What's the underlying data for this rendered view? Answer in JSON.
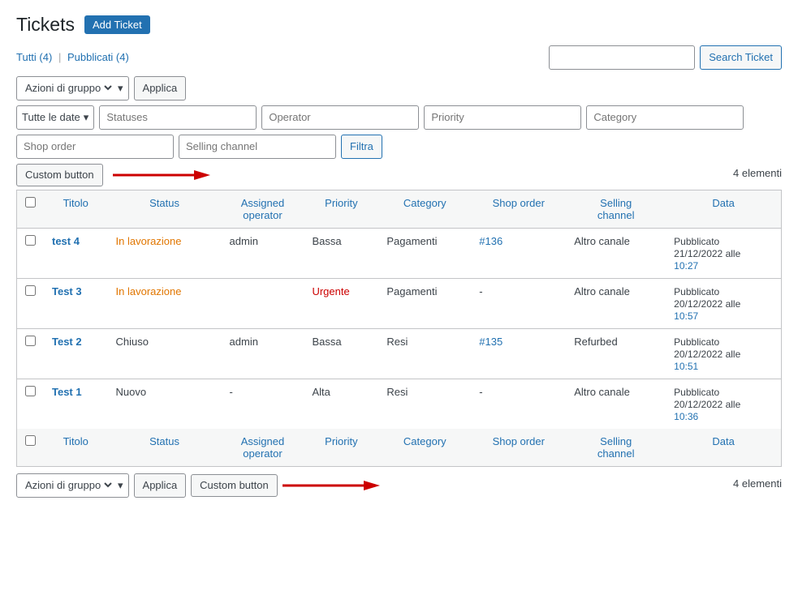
{
  "header": {
    "title": "Tickets",
    "add_ticket_label": "Add Ticket"
  },
  "filter_links": {
    "all": "Tutti (4)",
    "published": "Pubblicati (4)"
  },
  "search": {
    "placeholder": "",
    "button_label": "Search Ticket"
  },
  "actions": {
    "group_select_label": "Azioni di gruppo",
    "applica_label": "Applica",
    "custom_button_label": "Custom button",
    "elementi_count": "4 elementi"
  },
  "filters": {
    "date_label": "Tutte le date",
    "statuses_placeholder": "Statuses",
    "operator_placeholder": "Operator",
    "priority_placeholder": "Priority",
    "category_placeholder": "Category",
    "shop_order_placeholder": "Shop order",
    "selling_channel_placeholder": "Selling channel",
    "filtra_label": "Filtra"
  },
  "table": {
    "columns": [
      "Titolo",
      "Status",
      "Assigned operator",
      "Priority",
      "Category",
      "Shop order",
      "Selling channel",
      "Data"
    ],
    "rows": [
      {
        "id": "test4",
        "title": "test 4",
        "status": "In lavorazione",
        "status_class": "in-lav",
        "operator": "admin",
        "priority": "Bassa",
        "priority_class": "bassa",
        "category": "Pagamenti",
        "shop_order": "#136",
        "shop_order_link": true,
        "selling_channel": "Altro canale",
        "date_label": "Pubblicato",
        "date": "21/12/2022 alle",
        "time": "10:27"
      },
      {
        "id": "test3",
        "title": "Test 3",
        "status": "In lavorazione",
        "status_class": "in-lav",
        "operator": "",
        "priority": "Urgente",
        "priority_class": "urgente",
        "category": "Pagamenti",
        "shop_order": "-",
        "shop_order_link": false,
        "selling_channel": "Altro canale",
        "date_label": "Pubblicato",
        "date": "20/12/2022 alle",
        "time": "10:57"
      },
      {
        "id": "test2",
        "title": "Test 2",
        "status": "Chiuso",
        "status_class": "chiuso",
        "operator": "admin",
        "priority": "Bassa",
        "priority_class": "bassa",
        "category": "Resi",
        "shop_order": "#135",
        "shop_order_link": true,
        "selling_channel": "Refurbed",
        "date_label": "Pubblicato",
        "date": "20/12/2022 alle",
        "time": "10:51"
      },
      {
        "id": "test1",
        "title": "Test 1",
        "status": "Nuovo",
        "status_class": "nuovo",
        "operator": "-",
        "priority": "Alta",
        "priority_class": "alta",
        "category": "Resi",
        "shop_order": "-",
        "shop_order_link": false,
        "selling_channel": "Altro canale",
        "date_label": "Pubblicato",
        "date": "20/12/2022 alle",
        "time": "10:36"
      }
    ],
    "footer_columns": [
      "Titolo",
      "Status",
      "Assigned operator",
      "Priority",
      "Category",
      "Shop order",
      "Selling channel",
      "Data"
    ]
  },
  "bottom_bar": {
    "group_select_label": "Azioni di gruppo",
    "applica_label": "Applica",
    "custom_button_label": "Custom button",
    "elementi_count": "4 elementi"
  }
}
